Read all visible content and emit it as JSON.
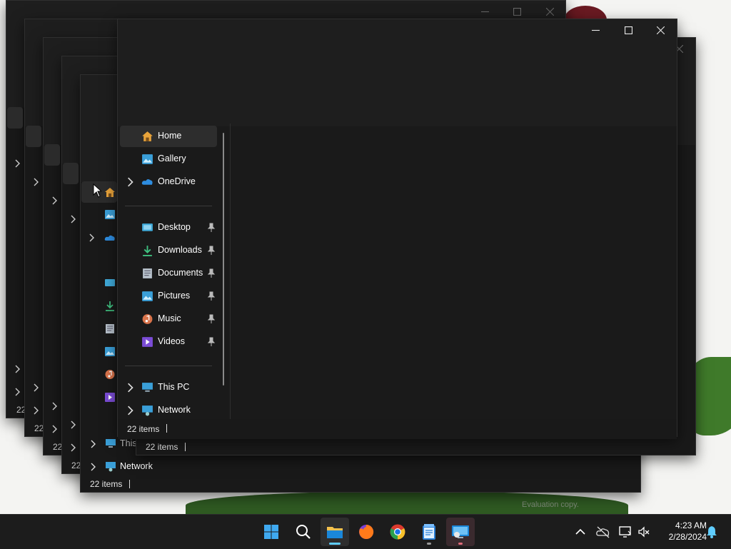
{
  "window": {
    "caption": {
      "minimize_icon": "minimize-icon",
      "maximize_icon": "maximize-icon",
      "close_icon": "close-icon"
    }
  },
  "nav": {
    "top": [
      {
        "label": "Home",
        "icon": "home-icon",
        "selected": true
      },
      {
        "label": "Gallery",
        "icon": "gallery-icon"
      },
      {
        "label": "OneDrive",
        "icon": "onedrive-icon",
        "expandable": true
      }
    ],
    "pinned": [
      {
        "label": "Desktop",
        "icon": "desktop-folder-icon"
      },
      {
        "label": "Downloads",
        "icon": "downloads-icon"
      },
      {
        "label": "Documents",
        "icon": "documents-icon"
      },
      {
        "label": "Pictures",
        "icon": "pictures-icon"
      },
      {
        "label": "Music",
        "icon": "music-icon"
      },
      {
        "label": "Videos",
        "icon": "videos-icon"
      }
    ],
    "bottom": [
      {
        "label": "This PC",
        "icon": "this-pc-icon",
        "expandable": true
      },
      {
        "label": "Network",
        "icon": "network-icon",
        "expandable": true
      }
    ]
  },
  "status": {
    "front": "22 items",
    "behind_1": "22 items",
    "behind_2": "22 items",
    "ghost_1": "22",
    "ghost_2": "22",
    "ghost_3": "22",
    "ghost_4": "22"
  },
  "ghost_nav": {
    "this_pc_partial": "This",
    "network": "Network"
  },
  "watermark": "Evaluation copy.",
  "taskbar": {
    "apps": [
      "start-icon",
      "search-icon",
      "file-explorer-icon",
      "firefox-icon",
      "chrome-icon",
      "notepad-icon",
      "remote-desktop-icon"
    ],
    "time": "4:23 AM",
    "date": "2/28/2024"
  },
  "colors": {
    "accent": "#60cdff",
    "window_bg": "#191919",
    "taskbar_bg": "#1c1c1c"
  }
}
